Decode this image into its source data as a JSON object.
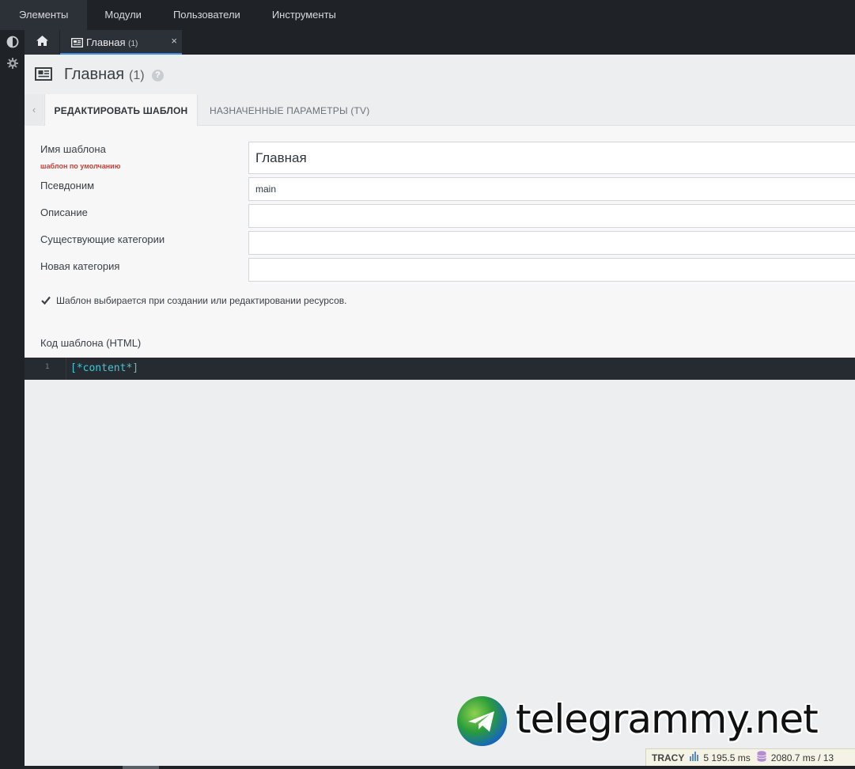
{
  "topmenu": [
    {
      "label": "Элементы"
    },
    {
      "label": "Модули"
    },
    {
      "label": "Пользователи"
    },
    {
      "label": "Инструменты"
    }
  ],
  "tabstrip": {
    "doc_tab_label": "Главная",
    "doc_tab_count": "(1)",
    "close_glyph": "×"
  },
  "header": {
    "title": "Главная",
    "count": "(1)",
    "help_glyph": "?"
  },
  "tabs": {
    "scroll_glyph": "‹",
    "edit_template": "РЕДАКТИРОВАТЬ ШАБЛОН",
    "assigned_tv": "НАЗНАЧЕННЫЕ ПАРАМЕТРЫ (TV)"
  },
  "form": {
    "name_label": "Имя шаблона",
    "name_sublabel": "шаблон по умолчанию",
    "name_value": "Главная",
    "alias_label": "Псевдоним",
    "alias_value": "main",
    "description_label": "Описание",
    "description_value": "",
    "categories_label": "Существующие категории",
    "categories_value": "",
    "new_category_label": "Новая категория",
    "new_category_value": "",
    "selectable_checked": true,
    "selectable_label": "Шаблон выбирается при создании или редактировании ресурсов.",
    "code_label": "Код шаблона (HTML)"
  },
  "editor": {
    "line_number": "1",
    "code": "[*content*]"
  },
  "watermark": {
    "text": "telegrammy.net"
  },
  "tracy": {
    "brand": "TRACY",
    "time": "5 195.5 ms",
    "db": "2080.7 ms / 13"
  },
  "icons": {
    "sidebar": [
      "contrast-icon",
      "gear-icon"
    ],
    "home": "home-icon",
    "tab": "newspaper-icon"
  },
  "colors": {
    "dark_bg": "#1f2328",
    "accent_blue": "#3a8ee6",
    "code_cyan": "#3fc7d8",
    "required_red": "#c9403a"
  }
}
